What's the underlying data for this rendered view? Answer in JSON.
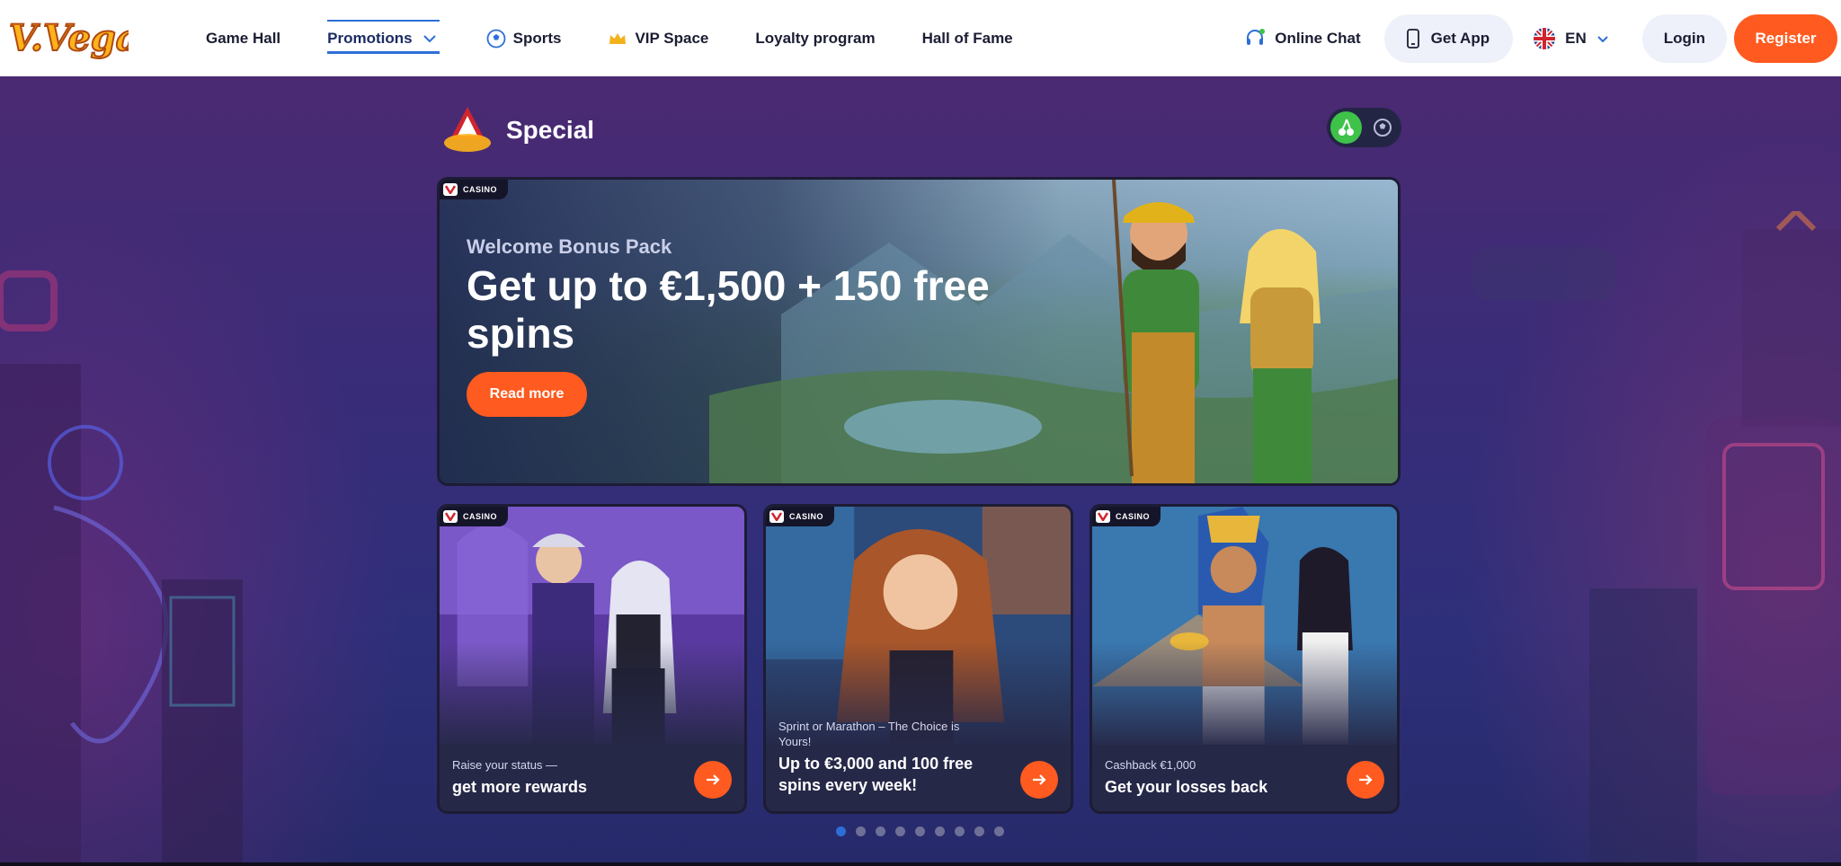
{
  "header": {
    "logo_text": "V.Vegas",
    "nav": [
      {
        "label": "Game Hall",
        "icon": ""
      },
      {
        "label": "Promotions",
        "icon": "chevron-down-icon",
        "active": true
      },
      {
        "label": "Sports",
        "icon": "soccer-ball-icon"
      },
      {
        "label": "VIP Space",
        "icon": "crown-icon"
      },
      {
        "label": "Loyalty program",
        "icon": ""
      },
      {
        "label": "Hall of Fame",
        "icon": ""
      }
    ],
    "online_chat": "Online Chat",
    "get_app": "Get App",
    "language": "EN",
    "login": "Login",
    "register": "Register"
  },
  "section": {
    "title": "Special",
    "toggle": [
      {
        "icon": "cherries-icon",
        "active": true
      },
      {
        "icon": "soccer-ball-icon",
        "active": false
      }
    ]
  },
  "hero": {
    "badge": "CASINO",
    "subtitle": "Welcome Bonus Pack",
    "title": "Get up to €1,500 + 150 free spins",
    "button": "Read more"
  },
  "cards": [
    {
      "badge": "CASINO",
      "subtitle": "Raise your status —",
      "title": "get more rewards"
    },
    {
      "badge": "CASINO",
      "subtitle": "Sprint or Marathon – The Choice is Yours!",
      "title": "Up to €3,000 and 100 free spins every week!"
    },
    {
      "badge": "CASINO",
      "subtitle": "Cashback €1,000",
      "title": "Get your losses back"
    }
  ],
  "pagination": {
    "total": 9,
    "active": 1
  },
  "colors": {
    "accent": "#ff5a1f",
    "nav_active": "#2d6fd6",
    "toggle_on": "#3ec24a",
    "page_bg": "#3a2c78"
  }
}
